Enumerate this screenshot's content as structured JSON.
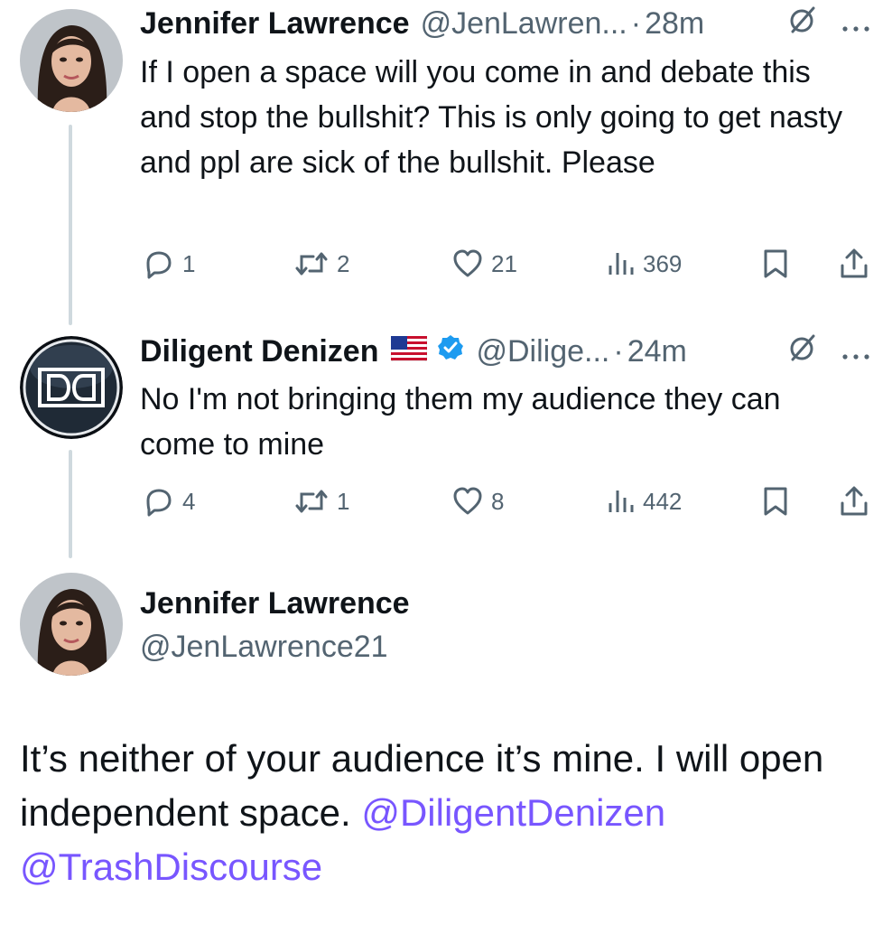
{
  "tweets": [
    {
      "name": "Jennifer Lawrence",
      "handle": "@JenLawren...",
      "separator": "·",
      "time": "28m",
      "text": "If I open a space will you come in and debate this and stop the bullshit? This is only going to get nasty and ppl are sick of the bullshit. Please",
      "replies": "1",
      "retweets": "2",
      "likes": "21",
      "views": "369"
    },
    {
      "name": "Diligent Denizen",
      "handle": "@Dilige...",
      "separator": "·",
      "time": "24m",
      "text": "No I'm not bringing them my audience they can come to mine",
      "replies": "4",
      "retweets": "1",
      "likes": "8",
      "views": "442"
    }
  ],
  "main_tweet": {
    "name": "Jennifer Lawrence",
    "handle": "@JenLawrence21",
    "text": "It’s neither of your audience it’s mine. I will open independent space.",
    "mention_1": "@DiligentDenizen",
    "mention_2": "@TrashDiscourse"
  },
  "icons": {
    "reply": "reply-icon",
    "retweet": "retweet-icon",
    "like": "heart-icon",
    "views": "views-icon",
    "bookmark": "bookmark-icon",
    "share": "share-icon",
    "grok": "grok-icon",
    "more": "more-icon",
    "verified": "verified-badge-icon",
    "flag": "us-flag-icon"
  },
  "colors": {
    "text": "#0f1419",
    "secondary": "#536471",
    "link": "#7856ff",
    "verified": "#1d9bf0",
    "thread_line": "#cfd9de"
  }
}
